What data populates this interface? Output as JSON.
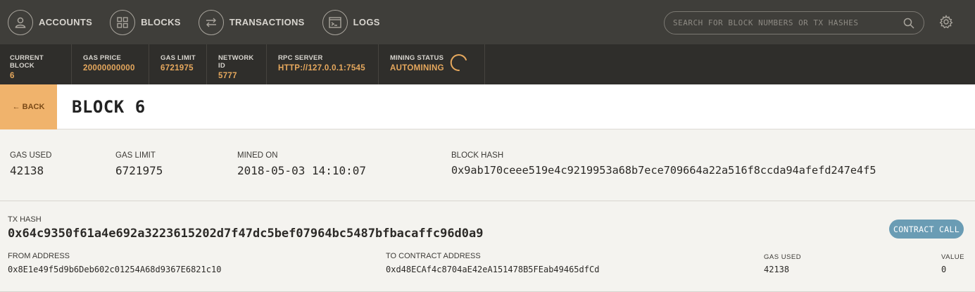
{
  "nav": {
    "items": [
      {
        "label": "ACCOUNTS",
        "icon": "user-icon"
      },
      {
        "label": "BLOCKS",
        "icon": "grid-icon"
      },
      {
        "label": "TRANSACTIONS",
        "icon": "swap-icon"
      },
      {
        "label": "LOGS",
        "icon": "terminal-icon"
      }
    ],
    "search_placeholder": "SEARCH FOR BLOCK NUMBERS OR TX HASHES"
  },
  "status": {
    "current_block": {
      "label": "CURRENT BLOCK",
      "value": "6"
    },
    "gas_price": {
      "label": "GAS PRICE",
      "value": "20000000000"
    },
    "gas_limit": {
      "label": "GAS LIMIT",
      "value": "6721975"
    },
    "network_id": {
      "label": "NETWORK ID",
      "value": "5777"
    },
    "rpc_server": {
      "label": "RPC SERVER",
      "value": "HTTP://127.0.0.1:7545"
    },
    "mining_status": {
      "label": "MINING STATUS",
      "value": "AUTOMINING"
    }
  },
  "block": {
    "back_label": "← BACK",
    "title": "BLOCK 6",
    "gas_used": {
      "label": "GAS USED",
      "value": "42138"
    },
    "gas_limit": {
      "label": "GAS LIMIT",
      "value": "6721975"
    },
    "mined_on": {
      "label": "MINED ON",
      "value": "2018-05-03 14:10:07"
    },
    "block_hash": {
      "label": "BLOCK HASH",
      "value": "0x9ab170ceee519e4c9219953a68b7ece709664a22a516f8ccda94afefd247e4f5"
    }
  },
  "transaction": {
    "hash_label": "TX HASH",
    "hash": "0x64c9350f61a4e692a3223615202d7f47dc5bef07964bc5487bfbacaffc96d0a9",
    "type_badge": "CONTRACT CALL",
    "from": {
      "label": "FROM ADDRESS",
      "value": "0x8E1e49f5d9b6Deb602c01254A68d9367E6821c10"
    },
    "to": {
      "label": "TO CONTRACT ADDRESS",
      "value": "0xd48ECAf4c8704aE42eA151478B5FEab49465dfCd"
    },
    "gas_used": {
      "label": "GAS USED",
      "value": "42138"
    },
    "value": {
      "label": "VALUE",
      "value": "0"
    }
  },
  "colors": {
    "accent": "#e6a85d",
    "nav_bg": "#3f3e3a",
    "status_bg": "#2f2e2b",
    "back_bg": "#f0b36c",
    "badge_bg": "#6a9cb4"
  }
}
